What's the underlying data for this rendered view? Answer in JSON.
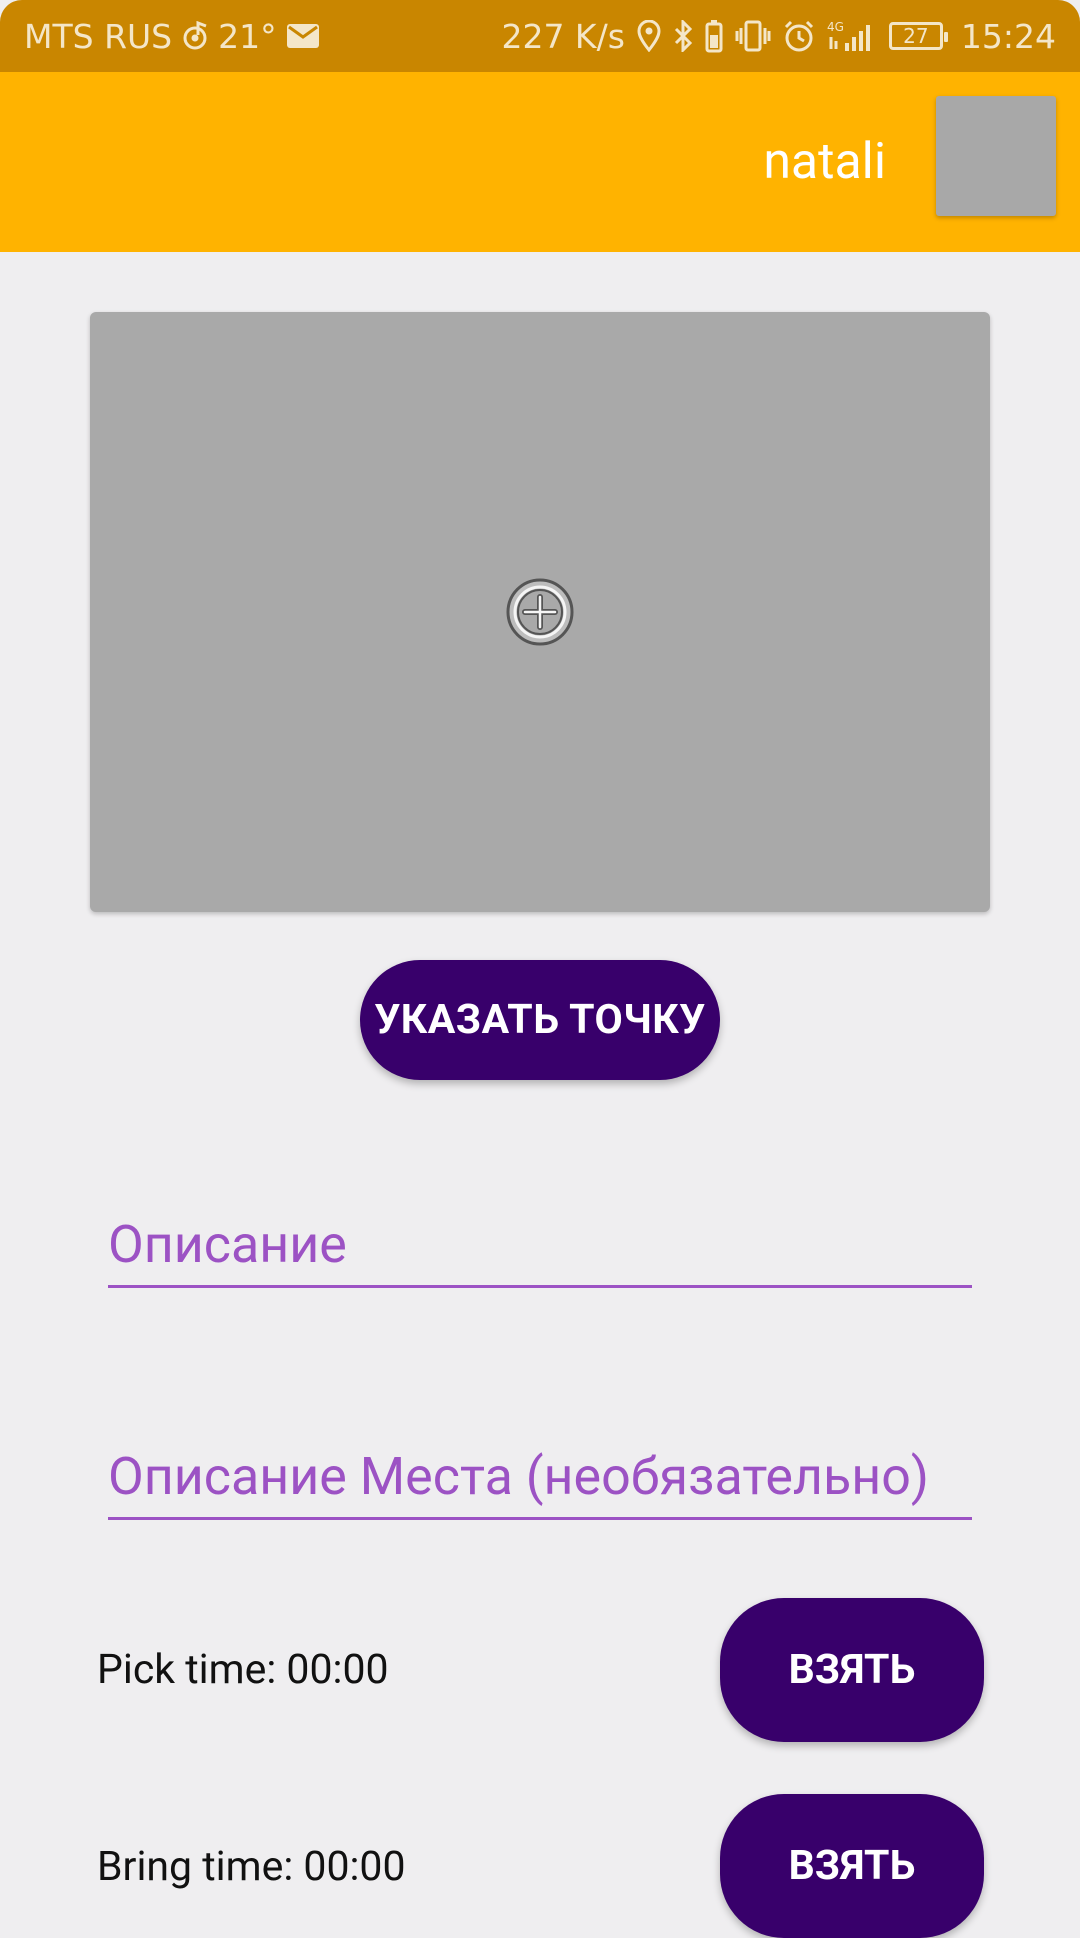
{
  "status_bar": {
    "carrier": "MTS RUS",
    "temperature": "21°",
    "network_speed": "227 K/s",
    "network_type": "4G",
    "battery_level": "27",
    "time": "15:24",
    "icons": [
      "music-note-icon",
      "mail-icon",
      "location-icon",
      "bluetooth-icon",
      "battery-saver-icon",
      "vibrate-icon",
      "alarm-icon",
      "signal-icon"
    ]
  },
  "app_bar": {
    "title": "natali",
    "background_color": "#ffb300"
  },
  "image_placeholder": {
    "icon": "add-circle-icon"
  },
  "point_button": {
    "label": "УКАЗАТЬ ТОЧКУ",
    "color": "#38006b"
  },
  "form": {
    "description": {
      "placeholder": "Описание",
      "value": ""
    },
    "place_description": {
      "placeholder": "Описание Места (необязательно)",
      "value": ""
    }
  },
  "pick": {
    "label": "Pick time: 00:00",
    "button_label": "ВЗЯТЬ"
  },
  "bring": {
    "label": "Bring time: 00:00",
    "button_label": "ВЗЯТЬ"
  },
  "colors": {
    "status_bar": "#c98600",
    "accent": "#9c52c4",
    "background": "#efeef0"
  }
}
